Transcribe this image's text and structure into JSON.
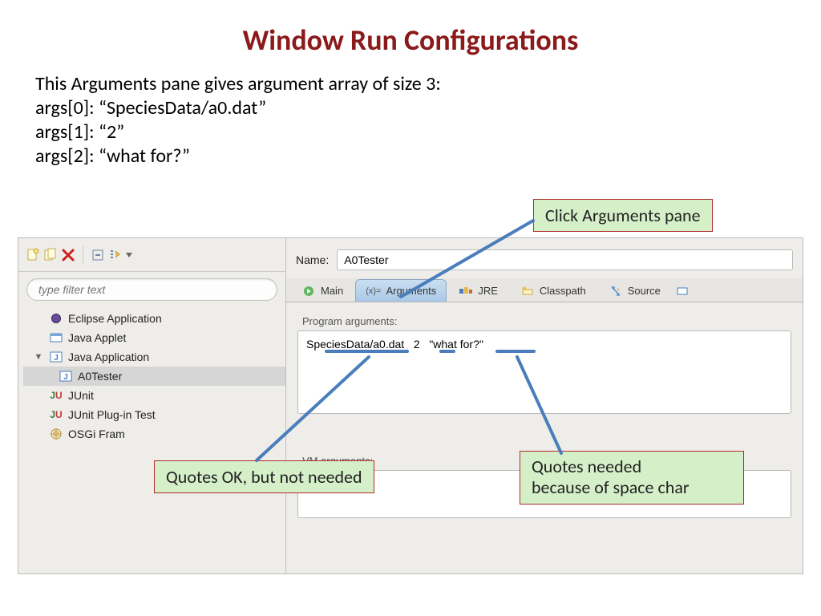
{
  "title": "Window Run Configurations",
  "intro": {
    "line1": "This Arguments pane gives argument array of size 3:",
    "line2": "args[0]: “SpeciesData/a0.dat”",
    "line3": "args[1]: “2”",
    "line4": "args[2]: “what for?”"
  },
  "filter_placeholder": "type filter text",
  "tree": {
    "eclipse_app": "Eclipse Application",
    "java_applet": "Java Applet",
    "java_application": "Java Application",
    "a0tester": "A0Tester",
    "junit": "JUnit",
    "junit_plugin": "JUnit Plug-in Test",
    "osgi": "OSGi Fram"
  },
  "name_label": "Name:",
  "name_value": "A0Tester",
  "tabs": {
    "main": "Main",
    "arguments": "Arguments",
    "jre": "JRE",
    "classpath": "Classpath",
    "source": "Source"
  },
  "program_arguments_label": "Program arguments:",
  "program_arguments_value": "SpeciesData/a0.dat   2   \"what for?\"",
  "vm_arguments_label": "VM arguments:",
  "callouts": {
    "click_args": "Click Arguments pane",
    "quotes_ok": "Quotes OK, but not needed",
    "quotes_needed_l1": "Quotes needed",
    "quotes_needed_l2": "because of space char"
  }
}
